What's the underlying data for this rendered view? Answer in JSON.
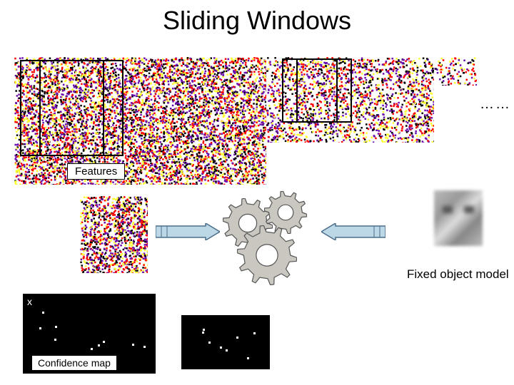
{
  "title": "Sliding Windows",
  "features_label": "Features",
  "ellipsis": "……",
  "fixed_model_label": "Fixed object model",
  "confidence_label": "Confidence map",
  "x_marker": "x",
  "noise_colors": [
    "#ff0000",
    "#ffff33",
    "#6a0dad",
    "#000000",
    "#ffffff",
    "#ffffff",
    "#ffffff"
  ],
  "gear_spec": {
    "teeth": 10,
    "outer": 30,
    "inner": 10,
    "fill": "#c9c7c0",
    "stroke": "#555"
  }
}
